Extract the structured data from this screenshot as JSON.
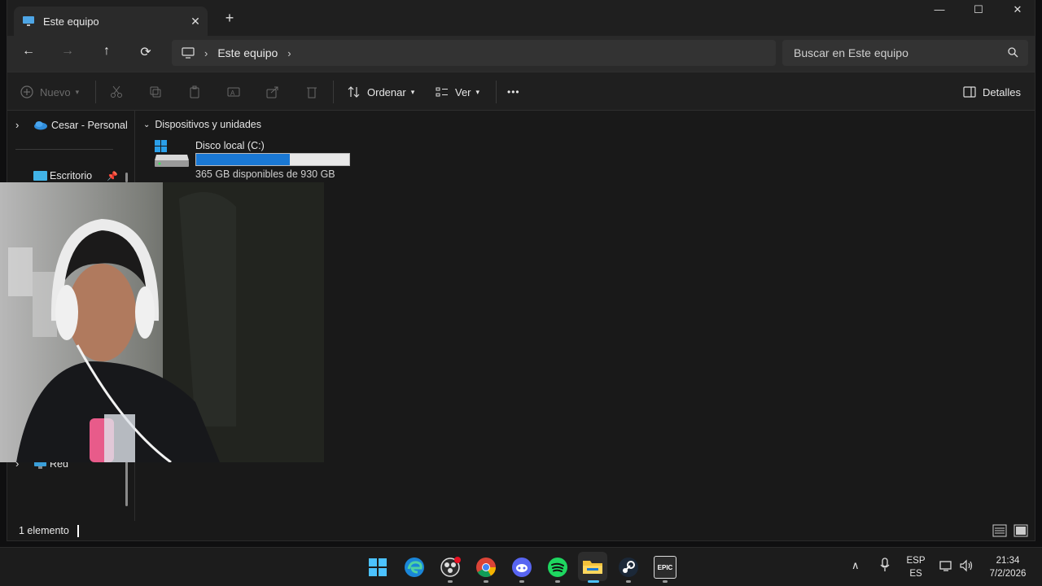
{
  "window": {
    "tab_title": "Este equipo",
    "tab_close": "✕",
    "new_tab": "+",
    "minimize": "—",
    "maximize": "☐",
    "close": "✕"
  },
  "nav": {
    "back": "←",
    "forward": "→",
    "up": "↑",
    "refresh": "⟳",
    "address": {
      "crumb": "Este equipo",
      "sep1": "›",
      "sep2": "›"
    },
    "search_placeholder": "Buscar en Este equipo"
  },
  "toolbar": {
    "new_label": "Nuevo",
    "sort_label": "Ordenar",
    "view_label": "Ver",
    "more_label": "•••",
    "details_label": "Detalles"
  },
  "sidebar": {
    "items": [
      {
        "label": "Cesar - Personal",
        "icon": "onedrive-icon"
      },
      {
        "label": "Escritorio",
        "icon": "desktop-folder-icon"
      },
      {
        "label": "Red",
        "icon": "network-icon"
      }
    ]
  },
  "content": {
    "section_title": "Dispositivos y unidades",
    "drive": {
      "name": "Disco local (C:)",
      "free_text": "365 GB disponibles de 930 GB",
      "used_fraction": 0.61
    }
  },
  "status": {
    "count": "1 elemento"
  },
  "taskbar": {
    "lang_top": "ESP",
    "lang_bottom": "ES",
    "time": "21:34",
    "date": "7/2/2026",
    "epic_label": "EPIC"
  },
  "colors": {
    "accent": "#1a78d4",
    "window_bg": "#191919",
    "bar_bg": "#2a2a2a"
  }
}
